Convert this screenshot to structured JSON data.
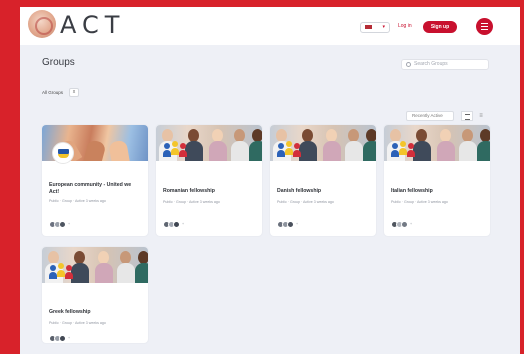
{
  "header": {
    "logo_text": "ACT",
    "lang_label": "",
    "login_label": "Log in",
    "signup_label": "Sign up"
  },
  "page": {
    "title": "Groups",
    "search_placeholder": "Search Groups",
    "filter_label": "All Groups",
    "filter_count": "x",
    "sort_label": "Recently Active"
  },
  "groups": [
    {
      "title": "European community - United we Act!",
      "meta": "Public  ·  Group  ·  Active 3 weeks ago",
      "member_extra": "+"
    },
    {
      "title": "Romanian fellowship",
      "meta": "Public  ·  Group  ·  Active 3 weeks ago",
      "member_extra": "+"
    },
    {
      "title": "Danish fellowship",
      "meta": "Public  ·  Group  ·  Active 3 weeks ago",
      "member_extra": "+"
    },
    {
      "title": "Italian fellowship",
      "meta": "Public  ·  Group  ·  Active 3 weeks ago",
      "member_extra": "+"
    },
    {
      "title": "Greek fellowship",
      "meta": "Public  ·  Group  ·  Active 3 weeks ago",
      "member_extra": "+"
    }
  ],
  "colors": {
    "accent": "#c8102e",
    "frame": "#d8222a",
    "background": "#eef0f6"
  },
  "icons": [
    "logo-icon",
    "flag-icon",
    "menu-icon",
    "search-icon",
    "grid-view-icon",
    "list-view-icon",
    "people-icon",
    "eu-badge-icon"
  ]
}
